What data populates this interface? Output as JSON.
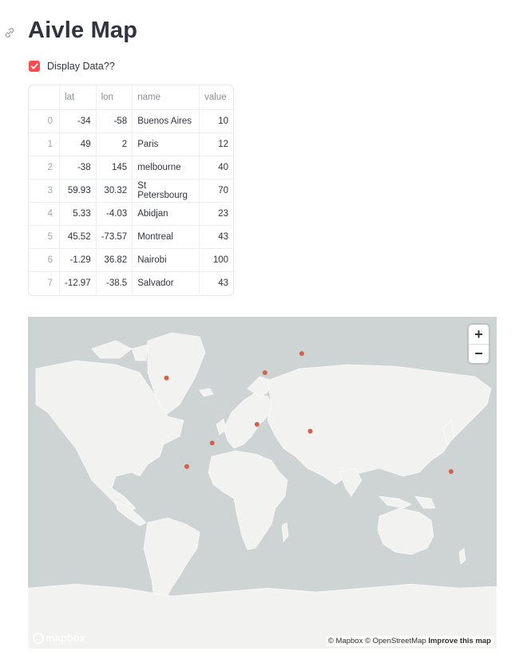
{
  "page": {
    "title": "Aivle Map"
  },
  "checkbox": {
    "label": "Display Data??",
    "checked": true,
    "color": "#ff4b4b"
  },
  "table": {
    "columns": [
      "",
      "lat",
      "lon",
      "name",
      "value"
    ],
    "rows": [
      {
        "index": "0",
        "lat": "-34",
        "lon": "-58",
        "name": "Buenos Aires",
        "value": "10"
      },
      {
        "index": "1",
        "lat": "49",
        "lon": "2",
        "name": "Paris",
        "value": "12"
      },
      {
        "index": "2",
        "lat": "-38",
        "lon": "145",
        "name": "melbourne",
        "value": "40"
      },
      {
        "index": "3",
        "lat": "59.93",
        "lon": "30.32",
        "name": "St Petersbourg",
        "value": "70"
      },
      {
        "index": "4",
        "lat": "5.33",
        "lon": "-4.03",
        "name": "Abidjan",
        "value": "23"
      },
      {
        "index": "5",
        "lat": "45.52",
        "lon": "-73.57",
        "name": "Montreal",
        "value": "43"
      },
      {
        "index": "6",
        "lat": "-1.29",
        "lon": "36.82",
        "name": "Nairobi",
        "value": "100"
      },
      {
        "index": "7",
        "lat": "-12.97",
        "lon": "-38.5",
        "name": "Salvador",
        "value": "43"
      }
    ]
  },
  "map": {
    "zoom_in_label": "+",
    "zoom_out_label": "−",
    "logo_text": "mapbox",
    "attribution": "© Mapbox © OpenStreetMap",
    "improve_label": "Improve this map",
    "marker_color": "#d0634a",
    "land_color": "#f2f2f1",
    "water_color": "#ced3d4"
  }
}
